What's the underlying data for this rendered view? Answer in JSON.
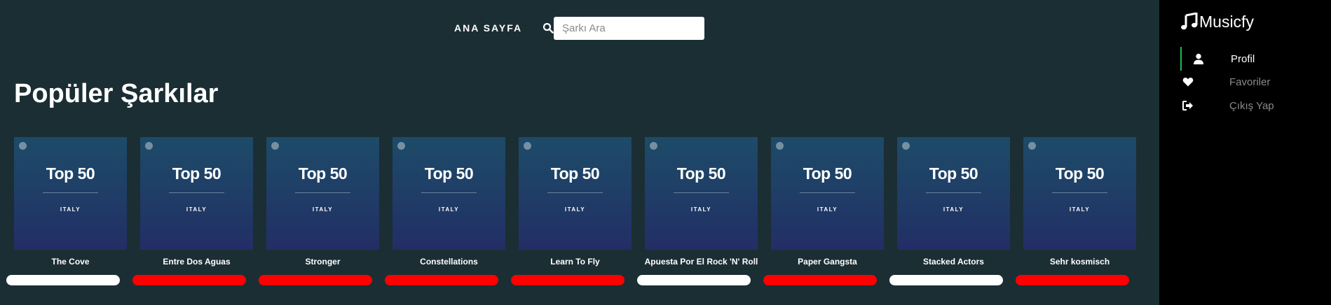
{
  "header": {
    "nav_home_label": "ANA SAYFA",
    "search_placeholder": "Şarkı Ara",
    "search_value": ""
  },
  "main": {
    "title": "Popüler Şarkılar",
    "cover_title": "Top 50",
    "cover_country": "ITALY",
    "cards": [
      {
        "title": "The Cove",
        "favorited": false
      },
      {
        "title": "Entre Dos Aguas",
        "favorited": true
      },
      {
        "title": "Stronger",
        "favorited": true
      },
      {
        "title": "Constellations",
        "favorited": true
      },
      {
        "title": "Learn To Fly",
        "favorited": true
      },
      {
        "title": "Apuesta Por El Rock 'N' Roll",
        "favorited": false
      },
      {
        "title": "Paper Gangsta",
        "favorited": true
      },
      {
        "title": "Stacked Actors",
        "favorited": false
      },
      {
        "title": "Sehr kosmisch",
        "favorited": true
      }
    ]
  },
  "sidebar": {
    "brand": "Musicfy",
    "items": [
      {
        "label": "Profil",
        "icon": "user-icon",
        "active": true
      },
      {
        "label": "Favoriler",
        "icon": "heart-icon",
        "active": false
      },
      {
        "label": "Çıkış Yap",
        "icon": "sign-out-icon",
        "active": false
      }
    ]
  },
  "colors": {
    "background": "#1b2e33",
    "sidebar": "#000000",
    "favorite_on": "#ff0000",
    "favorite_off": "#ffffff",
    "active_indicator": "#1db954"
  }
}
